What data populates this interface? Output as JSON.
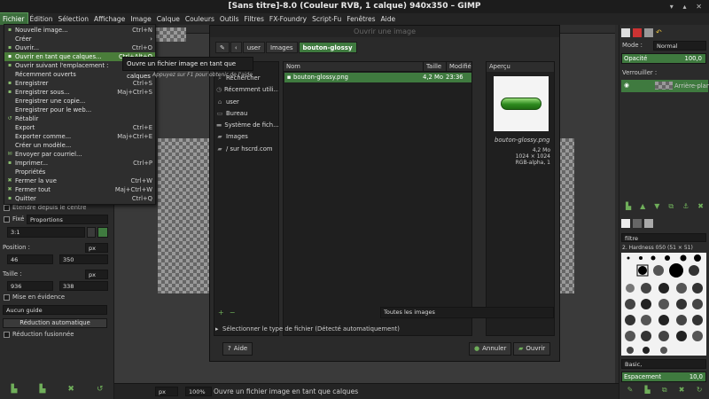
{
  "window": {
    "title": "[Sans titre]-8.0 (Couleur RVB, 1 calque) 940x350 – GIMP",
    "controls": "▾ ▴ ✕"
  },
  "menubar": [
    "Fichier",
    "Édition",
    "Sélection",
    "Affichage",
    "Image",
    "Calque",
    "Couleurs",
    "Outils",
    "Filtres",
    "FX-Foundry",
    "Script-Fu",
    "Fenêtres",
    "Aide"
  ],
  "file_menu": [
    {
      "label": "Nouvelle image...",
      "shortcut": "Ctrl+N",
      "icon": "new-image-icon"
    },
    {
      "label": "Créer",
      "shortcut": "",
      "submenu": true,
      "icon": ""
    },
    {
      "label": "Ouvrir...",
      "shortcut": "Ctrl+O",
      "icon": "open-icon"
    },
    {
      "label": "Ouvrir en tant que calques...",
      "shortcut": "Ctrl+Alt+O",
      "icon": "open-layers-icon",
      "highlighted": true
    },
    {
      "label": "Ouvrir suivant l'emplacement :",
      "shortcut": "",
      "icon": "location-icon"
    },
    {
      "label": "Récemment ouverts",
      "shortcut": "",
      "icon": ""
    },
    {
      "label": "Enregistrer",
      "shortcut": "Ctrl+S",
      "icon": "save-icon"
    },
    {
      "label": "Enregistrer sous...",
      "shortcut": "Maj+Ctrl+S",
      "icon": "save-as-icon"
    },
    {
      "label": "Enregistrer une copie...",
      "shortcut": "",
      "icon": ""
    },
    {
      "label": "Enregistrer pour le web...",
      "shortcut": "",
      "icon": ""
    },
    {
      "label": "Rétablir",
      "shortcut": "",
      "icon": "revert-icon"
    },
    {
      "label": "Export",
      "shortcut": "Ctrl+E",
      "icon": ""
    },
    {
      "label": "Exporter comme...",
      "shortcut": "Maj+Ctrl+E",
      "icon": ""
    },
    {
      "label": "Créer un modèle...",
      "shortcut": "",
      "icon": ""
    },
    {
      "label": "Envoyer par courriel...",
      "shortcut": "",
      "icon": "mail-icon"
    },
    {
      "label": "Imprimer...",
      "shortcut": "Ctrl+P",
      "icon": "print-icon"
    },
    {
      "label": "Propriétés",
      "shortcut": "",
      "icon": ""
    },
    {
      "label": "Fermer la vue",
      "shortcut": "Ctrl+W",
      "icon": "close-view-icon"
    },
    {
      "label": "Fermer tout",
      "shortcut": "Maj+Ctrl+W",
      "icon": "close-all-icon"
    },
    {
      "label": "Quitter",
      "shortcut": "Ctrl+Q",
      "icon": "quit-icon"
    }
  ],
  "tooltip": {
    "text": "Ouvre un fichier image en tant que calques",
    "help": "Appuyez sur F1 pour obtenir de l'aide"
  },
  "dialog": {
    "title": "Ouvrir une image",
    "path": [
      "user",
      "Images",
      "bouton-glossy"
    ],
    "places": [
      {
        "label": "Rechercher",
        "icon": "search-icon"
      },
      {
        "label": "Récemment utili...",
        "icon": "recent-icon"
      },
      {
        "label": "user",
        "icon": "home-icon"
      },
      {
        "label": "Bureau",
        "icon": "desktop-icon"
      },
      {
        "label": "Système de fich...",
        "icon": "drive-icon"
      },
      {
        "label": "Images",
        "icon": "folder-icon"
      },
      {
        "label": "/ sur hscrd.com",
        "icon": "network-icon"
      }
    ],
    "columns": {
      "name": "Nom",
      "size": "Taille",
      "modified": "Modifié"
    },
    "files": [
      {
        "name": "bouton-glossy.png",
        "size": "4,2 Mo",
        "modified": "23:36"
      }
    ],
    "preview": {
      "label": "Aperçu",
      "filename": "bouton-glossy.png",
      "size": "4,2 Mo",
      "dims": "1024 × 1024",
      "mode": "RGB-alpha, 1"
    },
    "filter": "Toutes les images",
    "filetype": "Sélectionner le type de fichier (Détecté automatiquement)",
    "help": "Aide",
    "cancel": "Annuler",
    "open": "Ouvrir"
  },
  "tool_options": {
    "expand_center": "Étendre depuis le centre",
    "fixed": "Fixé :",
    "fixed_value": "Proportions",
    "ratio": "3:1",
    "position": "Position :",
    "pos_unit": "px",
    "pos_x": "46",
    "pos_y": "350",
    "size": "Taille :",
    "size_unit": "px",
    "size_w": "936",
    "size_h": "338",
    "highlight": "Mise en évidence",
    "guides": "Aucun guide",
    "autoshrink": "Réduction automatique",
    "merged": "Réduction fusionnée"
  },
  "layers": {
    "mode_label": "Mode :",
    "mode": "Normal",
    "opacity_label": "Opacité",
    "opacity": "100,0",
    "lock_label": "Verrouiller :",
    "layer_name": "Arrière-plan"
  },
  "brushes": {
    "filter": "filtre",
    "brush_name": "2. Hardness 050 (51 × 51)",
    "preset": "Basic,",
    "spacing_label": "Espacement",
    "spacing": "10,0"
  },
  "status": {
    "unit": "px",
    "zoom": "100%",
    "message": "Ouvre un fichier image en tant que calques"
  },
  "colors": {
    "accent": "#3f7a3f",
    "menu_highlight": "#4a7d3a",
    "bg": "#2b2b2b"
  }
}
